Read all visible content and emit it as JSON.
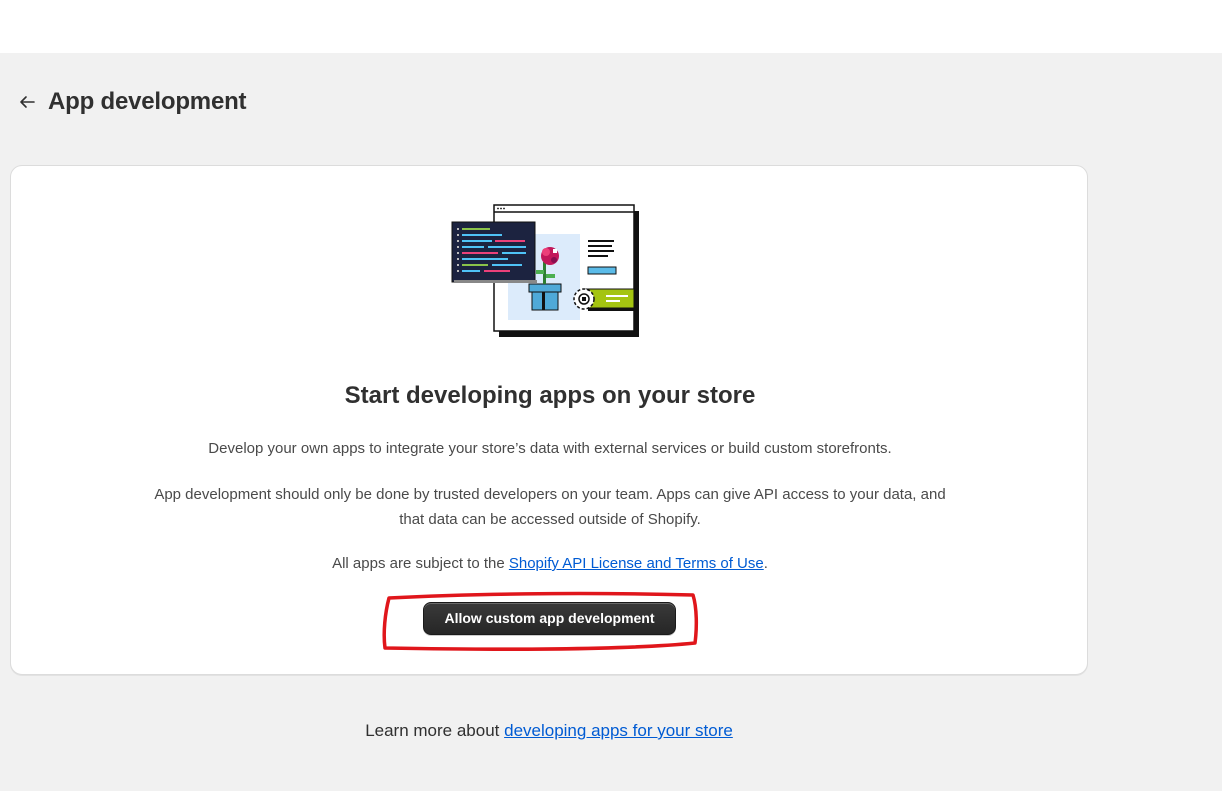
{
  "header": {
    "back_label": "←",
    "title": "App development"
  },
  "card": {
    "heading": "Start developing apps on your store",
    "description": "Develop your own apps to integrate your store’s data with external services or build custom storefronts.",
    "warning": "App development should only be done by trusted developers on your team. Apps can give API access to your data, and that data can be accessed outside of Shopify.",
    "terms_prefix": "All apps are subject to the ",
    "terms_link": "Shopify API License and Terms of Use",
    "terms_suffix": ".",
    "button_label": "Allow custom app development",
    "illustration_icon": "app-development-illustration",
    "annotation_color": "#e0161b"
  },
  "footer": {
    "prefix": "Learn more about ",
    "link": "developing apps for your store"
  },
  "colors": {
    "background": "#f1f1f1",
    "card": "#ffffff",
    "link": "#005bd3",
    "button": "#303030"
  }
}
